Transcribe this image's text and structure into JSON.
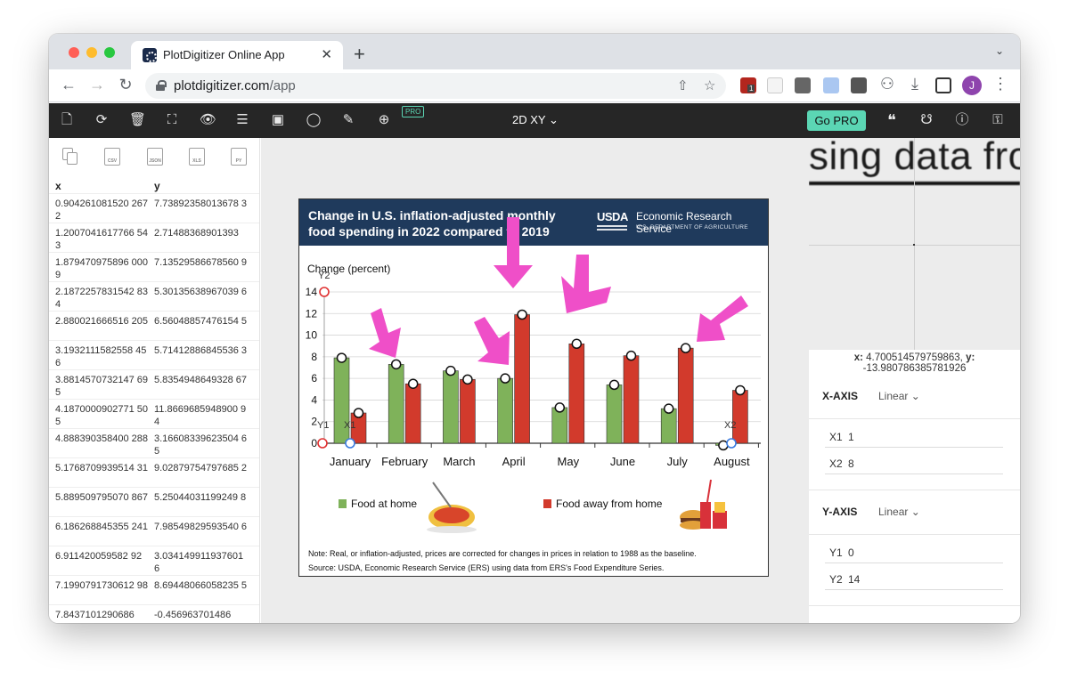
{
  "browser": {
    "tab_title": "PlotDigitizer Online App",
    "tab_close": "✕",
    "new_tab": "+",
    "url_host": "plotdigitizer.com",
    "url_path": "/app",
    "avatar_initial": "J",
    "ext_badge": "1"
  },
  "toolbar": {
    "pro_badge": "PRO",
    "mode": "2D XY",
    "go_pro": "Go PRO"
  },
  "export": {
    "icons": [
      "copy-icon",
      "csv-icon",
      "json-icon",
      "xls-icon",
      "py-icon"
    ],
    "labels": [
      "",
      "CSV",
      "JSON",
      "XLS",
      "PY"
    ]
  },
  "table": {
    "col_x": "x",
    "col_y": "y",
    "rows": [
      {
        "x": "0.904261081520 2672",
        "y": "7.73892358013678 3"
      },
      {
        "x": "1.2007041617766 543",
        "y": "2.71488368901393"
      },
      {
        "x": "1.879470975896 0009",
        "y": "7.13529586678560 9"
      },
      {
        "x": "2.1872257831542 834",
        "y": "5.30135638967039 6"
      },
      {
        "x": "2.880021666516 205",
        "y": "6.56048857476154 5"
      },
      {
        "x": "3.1932111582558 456",
        "y": "5.71412886845536 3"
      },
      {
        "x": "3.8814570732147 695",
        "y": "5.8354948649328 67"
      },
      {
        "x": "4.1870000902771 505",
        "y": "11.8669685948900 94"
      },
      {
        "x": "4.888390358400 288",
        "y": "3.16608339623504 65"
      },
      {
        "x": "5.1768709939514 31",
        "y": "9.02879754797685 2"
      },
      {
        "x": "5.889509795070 867",
        "y": "5.25044031199249 8"
      },
      {
        "x": "6.186268845355 241",
        "y": "7.98549829593540 6"
      },
      {
        "x": "6.911420059582 92",
        "y": "3.034149911937601 6"
      },
      {
        "x": "7.1990791730612 98",
        "y": "8.69448066058235 5"
      },
      {
        "x": "7.8437101290686",
        "y": "-0.456963701486"
      }
    ]
  },
  "magnifier": {
    "text": "sing data fro",
    "coord_x": "4.700514579759863",
    "coord_y": "-13.980786385781926"
  },
  "axes": {
    "x_title": "X-AXIS",
    "x_scale": "Linear",
    "x1_label": "X1",
    "x1_value": "1",
    "x2_label": "X2",
    "x2_value": "8",
    "y_title": "Y-AXIS",
    "y_scale": "Linear",
    "y1_label": "Y1",
    "y1_value": "0",
    "y2_label": "Y2",
    "y2_value": "14"
  },
  "figure": {
    "title_line1": "Change in U.S. inflation-adjusted monthly",
    "title_line2": "food spending in 2022 compared to 2019",
    "agency_logo": "USDA",
    "agency_name": "Economic Research Service",
    "agency_sub": "U.S. DEPARTMENT OF AGRICULTURE",
    "ylabel": "Change (percent)",
    "legend_home": "Food at home",
    "legend_away": "Food away from home",
    "note": "Note: Real, or inflation-adjusted, prices are corrected for changes in prices in relation to 1988 as the baseline.",
    "source": "Source: USDA, Economic Research Service (ERS) using data from ERS's Food Expenditure Series.",
    "calib_y2": "Y2",
    "calib_y1": "Y1",
    "calib_x1": "X1",
    "calib_x2": "X2"
  },
  "chart_data": {
    "type": "bar",
    "title": "Change in U.S. inflation-adjusted monthly food spending in 2022 compared to 2019",
    "ylabel": "Change (percent)",
    "xlabel": "",
    "ylim": [
      0,
      14
    ],
    "yticks": [
      0,
      2,
      4,
      6,
      8,
      10,
      12,
      14
    ],
    "categories": [
      "January",
      "February",
      "March",
      "April",
      "May",
      "June",
      "July",
      "August"
    ],
    "series": [
      {
        "name": "Food at home",
        "color": "#7fb25a",
        "values": [
          7.9,
          7.3,
          6.7,
          6.0,
          3.3,
          5.4,
          3.2,
          -0.2
        ]
      },
      {
        "name": "Food away from home",
        "color": "#d23a2c",
        "values": [
          2.8,
          5.5,
          5.9,
          11.9,
          9.2,
          8.1,
          8.8,
          4.9
        ]
      }
    ],
    "grid": true,
    "legend": "bottom"
  },
  "colors": {
    "accent": "#5bd6b4",
    "annotation": "#ef4fc8",
    "banner": "#1f3a5c"
  }
}
